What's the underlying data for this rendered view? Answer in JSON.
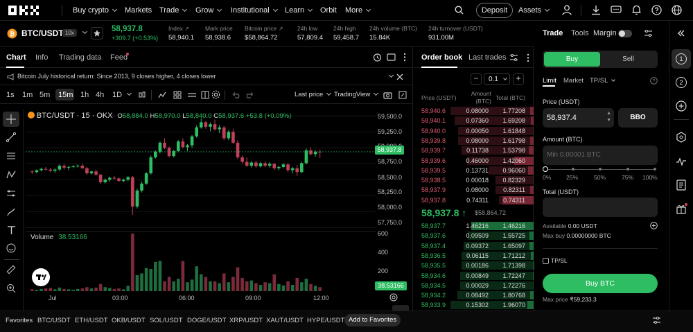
{
  "nav": {
    "items": [
      {
        "label": "Buy crypto",
        "dropdown": true
      },
      {
        "label": "Markets",
        "dropdown": false
      },
      {
        "label": "Trade",
        "dropdown": true
      },
      {
        "label": "Grow",
        "dropdown": true
      },
      {
        "label": "Institutional",
        "dropdown": true
      },
      {
        "label": "Learn",
        "dropdown": true
      },
      {
        "label": "Orbit",
        "dropdown": false
      },
      {
        "label": "More",
        "dropdown": true
      }
    ],
    "deposit": "Deposit",
    "assets": "Assets"
  },
  "ticker": {
    "pair": "BTC/USDT",
    "leverage": "10x",
    "last_price": "58,937.8",
    "change": "+309.7 (+0.53%)",
    "stats": [
      {
        "label": "Index",
        "value": "58,940.1",
        "ext": true
      },
      {
        "label": "Mark price",
        "value": "58,938.6",
        "ext": false
      },
      {
        "label": "Bitcoin price",
        "value": "$58,864.72",
        "ext": true
      },
      {
        "label": "24h low",
        "value": "57,809.4",
        "ext": false
      },
      {
        "label": "24h high",
        "value": "59,458.7",
        "ext": false
      },
      {
        "label": "24h volume (BTC)",
        "value": "15.84K",
        "ext": false
      },
      {
        "label": "24h turnover (USDT)",
        "value": "931.00M",
        "ext": false
      }
    ]
  },
  "chart_panel": {
    "tabs": [
      "Chart",
      "Info",
      "Trading data",
      "Feed"
    ],
    "banner": "Bitcoin July historical return: Since 2013, 9 closes higher, 4 closes lower",
    "timeframes": [
      "1s",
      "1m",
      "5m",
      "15m",
      "1h",
      "4h",
      "1D"
    ],
    "active_timeframe": "15m",
    "last_price_btn": "Last price",
    "tradingview_btn": "TradingView",
    "legend": {
      "symbol": "BTC/USDT · 15 · OKX",
      "o": "58,884.0",
      "h": "58,970.0",
      "l": "58,840.0",
      "c": "58,937.6",
      "chg": "+53.8 (+0.09%)"
    },
    "volume_label": "Volume",
    "volume_value": "38.53166",
    "price_tag": "58,937.8",
    "volume_tag": "38.53166"
  },
  "chart_data": {
    "type": "candlestick",
    "title": "BTC/USDT · 15 · OKX",
    "xlabels": [
      "Jul",
      "03:00",
      "06:00",
      "09:00",
      "12:00"
    ],
    "yticks": [
      "59,500.0",
      "59,250.0",
      "59,000.0",
      "58,750.0",
      "58,500.0",
      "58,250.0",
      "58,000.0",
      "57,750.0"
    ],
    "ylim": [
      57700,
      59600
    ],
    "volume_ticks": [
      "600",
      "400",
      "200"
    ],
    "volume_ylim": [
      0,
      650
    ],
    "last_price": 58937.8,
    "candles": [
      [
        58630,
        58650,
        58590,
        58620
      ],
      [
        58620,
        58660,
        58600,
        58650
      ],
      [
        58650,
        58690,
        58630,
        58670
      ],
      [
        58670,
        58700,
        58640,
        58660
      ],
      [
        58660,
        58690,
        58620,
        58640
      ],
      [
        58640,
        58680,
        58610,
        58660
      ],
      [
        58660,
        58740,
        58640,
        58720
      ],
      [
        58720,
        58740,
        58660,
        58690
      ],
      [
        58690,
        58720,
        58650,
        58700
      ],
      [
        58700,
        58730,
        58680,
        58710
      ],
      [
        58710,
        58740,
        58690,
        58720
      ],
      [
        58720,
        58750,
        58670,
        58680
      ],
      [
        58680,
        58700,
        58580,
        58600
      ],
      [
        58600,
        58640,
        58580,
        58630
      ],
      [
        58630,
        58660,
        58560,
        58580
      ],
      [
        58580,
        58590,
        58430,
        58460
      ],
      [
        58460,
        58520,
        58440,
        58500
      ],
      [
        58500,
        58550,
        58470,
        58530
      ],
      [
        58530,
        58560,
        58500,
        58520
      ],
      [
        58520,
        58540,
        58470,
        58480
      ],
      [
        58480,
        58520,
        58460,
        58500
      ],
      [
        58500,
        58560,
        58480,
        58540
      ],
      [
        58540,
        58560,
        57950,
        58080
      ],
      [
        58080,
        58360,
        58050,
        58330
      ],
      [
        58330,
        58470,
        58300,
        58440
      ],
      [
        58440,
        58620,
        58420,
        58600
      ],
      [
        58600,
        58880,
        58580,
        58850
      ],
      [
        58850,
        58960,
        58830,
        58940
      ],
      [
        58940,
        59100,
        58910,
        59080
      ],
      [
        59080,
        59150,
        58980,
        59000
      ],
      [
        59000,
        59020,
        58850,
        58870
      ],
      [
        58870,
        58970,
        58850,
        58950
      ],
      [
        58950,
        59120,
        58930,
        59100
      ],
      [
        59100,
        59150,
        58990,
        59010
      ],
      [
        59010,
        59060,
        58950,
        59040
      ],
      [
        59040,
        59200,
        59000,
        59180
      ],
      [
        59180,
        59350,
        59160,
        59320
      ],
      [
        59320,
        59460,
        59300,
        59400
      ],
      [
        59400,
        59420,
        59300,
        59330
      ],
      [
        59330,
        59400,
        59260,
        59370
      ],
      [
        59370,
        59440,
        59270,
        59290
      ],
      [
        59290,
        59360,
        59230,
        59320
      ],
      [
        59320,
        59340,
        59120,
        59150
      ],
      [
        59150,
        59280,
        59120,
        59250
      ],
      [
        59250,
        59300,
        59060,
        59080
      ],
      [
        59080,
        59120,
        58820,
        58850
      ],
      [
        58850,
        58880,
        58750,
        58780
      ],
      [
        58780,
        58850,
        58700,
        58720
      ],
      [
        58720,
        58790,
        58690,
        58770
      ],
      [
        58770,
        58800,
        58690,
        58710
      ],
      [
        58710,
        58780,
        58690,
        58760
      ],
      [
        58760,
        58790,
        58700,
        58720
      ],
      [
        58720,
        58780,
        58690,
        58750
      ],
      [
        58750,
        58760,
        58650,
        58680
      ],
      [
        58680,
        58720,
        58650,
        58700
      ],
      [
        58700,
        58760,
        58680,
        58740
      ],
      [
        58740,
        58760,
        58620,
        58650
      ],
      [
        58650,
        58700,
        58600,
        58680
      ],
      [
        58680,
        58730,
        58560,
        58620
      ],
      [
        58620,
        58780,
        58600,
        58760
      ],
      [
        58760,
        58990,
        58740,
        58960
      ],
      [
        58960,
        59010,
        58880,
        58900
      ],
      [
        58900,
        58960,
        58860,
        58940
      ],
      [
        58940,
        58970,
        58840,
        58937.6
      ]
    ],
    "volumes": [
      20,
      15,
      25,
      30,
      35,
      20,
      40,
      25,
      20,
      15,
      25,
      30,
      45,
      30,
      40,
      80,
      45,
      35,
      25,
      30,
      20,
      60,
      650,
      180,
      200,
      260,
      250,
      330,
      340,
      110,
      160,
      110,
      140,
      340,
      100,
      130,
      280,
      190,
      160,
      110,
      110,
      90,
      200,
      100,
      160,
      270,
      150,
      110,
      120,
      90,
      70,
      100,
      90,
      190,
      80,
      65,
      110,
      70,
      150,
      100,
      140,
      80,
      60,
      45
    ]
  },
  "order_book": {
    "tabs": [
      "Order book",
      "Last trades"
    ],
    "precision": "0.1",
    "headers": [
      "Price (USDT)",
      "Amount (BTC)",
      "Total (BTC)"
    ],
    "asks": [
      {
        "price": "58,940.6",
        "amount": "0.08000",
        "total": "1.77208",
        "depth": 1.0
      },
      {
        "price": "58,940.1",
        "amount": "0.07360",
        "total": "1.69208",
        "depth": 0.95
      },
      {
        "price": "58,940.0",
        "amount": "0.00050",
        "total": "1.61848",
        "depth": 0.91
      },
      {
        "price": "58,939.8",
        "amount": "0.08000",
        "total": "1.61798",
        "depth": 0.91
      },
      {
        "price": "58,939.7",
        "amount": "0.11738",
        "total": "1.53798",
        "depth": 0.87
      },
      {
        "price": "58,939.6",
        "amount": "0.46000",
        "total": "1.42060",
        "depth": 0.8
      },
      {
        "price": "58,939.5",
        "amount": "0.13731",
        "total": "0.96060",
        "depth": 0.54
      },
      {
        "price": "58,938.5",
        "amount": "0.00018",
        "total": "0.82329",
        "depth": 0.46
      },
      {
        "price": "58,937.9",
        "amount": "0.08000",
        "total": "0.82311",
        "depth": 0.46
      },
      {
        "price": "58,937.8",
        "amount": "0.74311",
        "total": "0.74311",
        "depth": 0.42
      }
    ],
    "mid_price": "58,937.8",
    "mid_usd": "$58,864.72",
    "bids": [
      {
        "price": "58,937.7",
        "amount": "1.46216",
        "total": "1.46216",
        "depth": 0.75
      },
      {
        "price": "58,937.6",
        "amount": "0.09509",
        "total": "1.55725",
        "depth": 0.79
      },
      {
        "price": "58,937.4",
        "amount": "0.09372",
        "total": "1.65097",
        "depth": 0.84
      },
      {
        "price": "58,936.5",
        "amount": "0.06115",
        "total": "1.71212",
        "depth": 0.87
      },
      {
        "price": "58,935.5",
        "amount": "0.00186",
        "total": "1.71398",
        "depth": 0.87
      },
      {
        "price": "58,934.6",
        "amount": "0.00849",
        "total": "1.72247",
        "depth": 0.88
      },
      {
        "price": "58,934.5",
        "amount": "0.00029",
        "total": "1.72276",
        "depth": 0.88
      },
      {
        "price": "58,934.2",
        "amount": "0.08492",
        "total": "1.80768",
        "depth": 0.92
      },
      {
        "price": "58,933.9",
        "amount": "0.15302",
        "total": "1.96070",
        "depth": 1.0
      }
    ]
  },
  "trade_panel": {
    "tabs": [
      "Trade",
      "Tools"
    ],
    "margin_label": "Margin",
    "buy": "Buy",
    "sell": "Sell",
    "order_types": [
      "Limit",
      "Market",
      "TP/SL"
    ],
    "price_label": "Price (USDT)",
    "price_value": "58,937.4",
    "bbo": "BBO",
    "amount_label": "Amount (BTC)",
    "amount_placeholder": "Min 0.00001 BTC",
    "slider_marks": [
      "0%",
      "25%",
      "50%",
      "75%",
      "100%"
    ],
    "total_label": "Total (USDT)",
    "available_label": "Available",
    "available_value": "0.00 USDT",
    "max_buy_label": "Max buy",
    "max_buy_value": "0.00000000 BTC",
    "tpsl_label": "TP/SL",
    "buy_button": "Buy BTC",
    "max_price_label": "Max price",
    "max_price_value": "₹59,233.3"
  },
  "rail": {
    "badges": [
      "1",
      "2"
    ]
  },
  "footer": {
    "label": "Favorites",
    "items": [
      "BTC/USDT",
      "ETH/USDT",
      "OKB/USDT",
      "SOL/USDT",
      "DOGE/USDT",
      "XRP/USDT",
      "XAUT/USDT",
      "HYPE/USDT"
    ],
    "add": "Add to Favorites"
  },
  "colors": {
    "up": "#2ebd62",
    "down": "#c0405a",
    "accent": "#2ebd62",
    "bg": "#000000"
  }
}
